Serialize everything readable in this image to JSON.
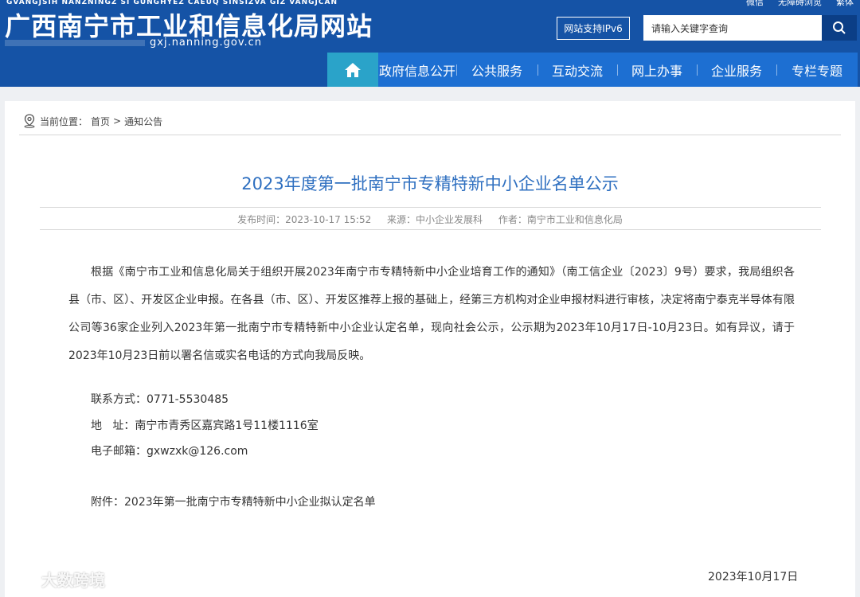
{
  "header": {
    "pinyin": "GVANGJSIH NANZNINGZ SI GUNGHYEZ CAEUQ SINSIZVA GIZ VANGJCAN",
    "site_title": "广西南宁市工业和信息化局网站",
    "domain": "gxj.nanning.gov.cn",
    "top_links": [
      "微信",
      "无障碍浏览",
      "繁体"
    ],
    "ipv6_label": "网站支持IPv6",
    "search_placeholder": "请输入关键字查询",
    "colors": {
      "header_bg": "#1553a6",
      "nav_bg": "#1d6fd2",
      "home_bg": "#2aa3c9"
    }
  },
  "nav": {
    "items": [
      "政府信息公开",
      "公共服务",
      "互动交流",
      "网上办事",
      "企业服务",
      "专栏专题"
    ]
  },
  "breadcrumb": {
    "prefix": "当前位置：",
    "home": "首页",
    "sep": ">",
    "current": "通知公告"
  },
  "article": {
    "title": "2023年度第一批南宁市专精特新中小企业名单公示",
    "meta": {
      "publish": "发布时间：2023-10-17 15:52",
      "source": "来源：中小企业发展科",
      "author": "作者：南宁市工业和信息化局"
    },
    "paragraph": "根据《南宁市工业和信息化局关于组织开展2023年南宁市专精特新中小企业培育工作的通知》（南工信企业〔2023〕9号）要求，我局组织各县（市、区）、开发区企业申报。在各县（市、区）、开发区推荐上报的基础上，经第三方机构对企业申报材料进行审核，决定将南宁泰克半导体有限公司等36家企业列入2023年第一批南宁市专精特新中小企业认定名单，现向社会公示，公示期为2023年10月17日-10月23日。如有异议，请于2023年10月23日前以署名信或实名电话的方式向我局反映。",
    "contact": "联系方式：0771-5530485",
    "address": "地   址：南宁市青秀区嘉宾路1号11楼1116室",
    "email": "电子邮箱：gxwzxk@126.com",
    "attachment": "附件：2023年第一批南宁市专精特新中小企业拟认定名单",
    "date": "2023年10月17日"
  },
  "watermark": "大数跨境"
}
